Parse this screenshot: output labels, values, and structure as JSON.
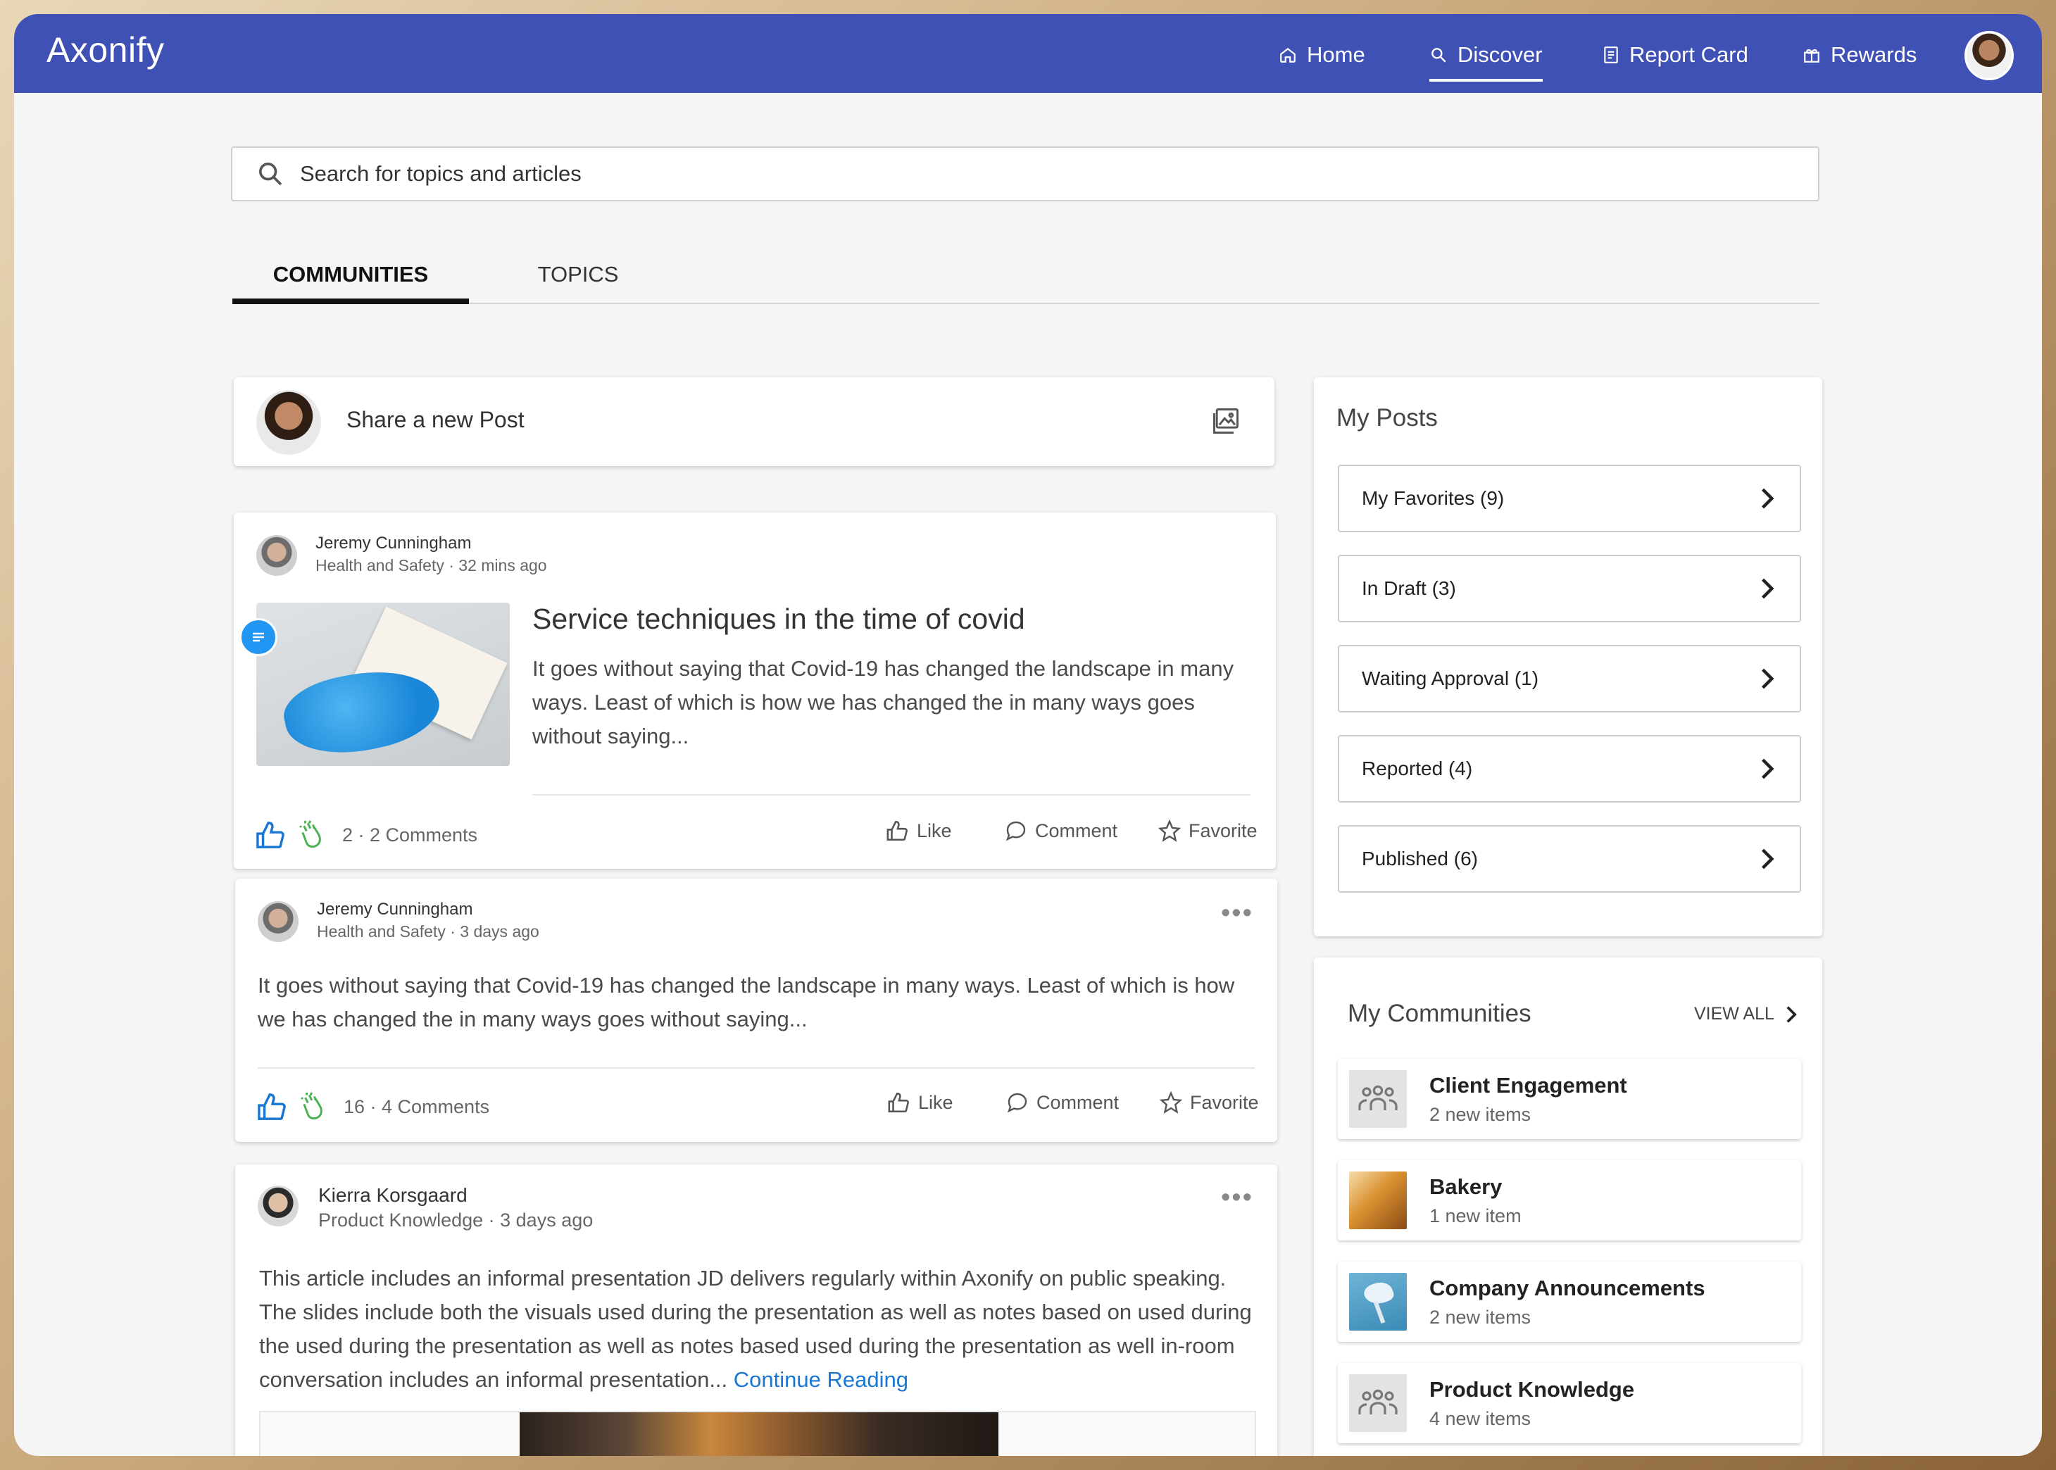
{
  "app": {
    "logo": "Axonify"
  },
  "nav": {
    "items": [
      {
        "label": "Home",
        "icon": "home-icon"
      },
      {
        "label": "Discover",
        "icon": "search-icon",
        "active": true
      },
      {
        "label": "Report Card",
        "icon": "report-icon"
      },
      {
        "label": "Rewards",
        "icon": "gift-icon"
      }
    ]
  },
  "search": {
    "placeholder": "Search for topics and articles"
  },
  "tabs": [
    {
      "label": "COMMUNITIES",
      "active": true
    },
    {
      "label": "TOPICS",
      "active": false
    }
  ],
  "share": {
    "label": "Share a new Post"
  },
  "posts": [
    {
      "author": "Jeremy Cunningham",
      "meta": "Health and Safety · 32 mins ago",
      "title": "Service techniques in the time of covid",
      "body": "It goes without saying that Covid-19 has changed the landscape in many ways. Least of which is how we has changed the in many ways goes without saying...",
      "stats": "2 · 2 Comments"
    },
    {
      "author": "Jeremy Cunningham",
      "meta": "Health and Safety · 3 days ago",
      "body": "It goes without saying that Covid-19 has changed the landscape in many ways. Least of which is how we has changed the in many ways goes without saying...",
      "stats": "16 · 4 Comments"
    },
    {
      "author": "Kierra Korsgaard",
      "meta": "Product Knowledge · 3 days ago",
      "body": "This article includes an informal presentation JD delivers regularly within Axonify on public speaking. The slides include both the visuals used during the presentation as well as notes based on used during the used during the presentation as well as notes based used during the presentation as well in-room conversation includes an informal presentation...",
      "continue": "Continue Reading"
    }
  ],
  "actions": {
    "like": "Like",
    "comment": "Comment",
    "favorite": "Favorite"
  },
  "my_posts": {
    "title": "My Posts",
    "items": [
      "My Favorites (9)",
      "In Draft (3)",
      "Waiting Approval (1)",
      "Reported (4)",
      "Published (6)"
    ]
  },
  "my_communities": {
    "title": "My Communities",
    "view_all": "VIEW ALL",
    "items": [
      {
        "name": "Client Engagement",
        "sub": "2 new items",
        "thumb": "people-icon"
      },
      {
        "name": "Bakery",
        "sub": "1 new item",
        "thumb": "bakery-photo"
      },
      {
        "name": "Company Announcements",
        "sub": "2 new items",
        "thumb": "announcement-photo"
      },
      {
        "name": "Product Knowledge",
        "sub": "4 new items",
        "thumb": "people-icon"
      }
    ]
  },
  "colors": {
    "brand": "#3f51b5",
    "link": "#1976d2",
    "background": "#f5f5f5"
  }
}
